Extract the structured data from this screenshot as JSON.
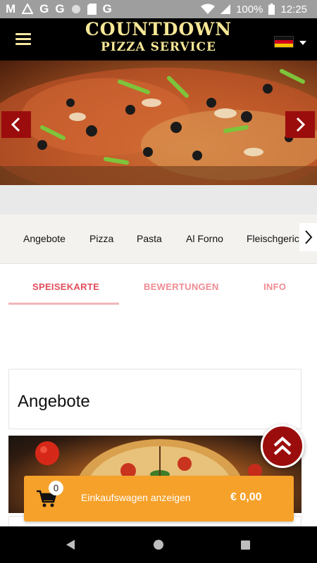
{
  "statusbar": {
    "left_glyphs": [
      "M",
      "G",
      "G",
      "G"
    ],
    "battery": "100%",
    "time": "12:25"
  },
  "header": {
    "logo_line1": "COUNTDOWN",
    "logo_line2": "PIZZA SERVICE",
    "language_flag": "de"
  },
  "categories": [
    "Angebote",
    "Pizza",
    "Pasta",
    "Al Forno",
    "Fleischgeric"
  ],
  "tabs": [
    "SPEISEKARTE",
    "BEWERTUNGEN",
    "INFO"
  ],
  "section": {
    "title": "Angebote"
  },
  "cart": {
    "count": "0",
    "label": "Einkaufswagen anzeigen",
    "total": "€ 0,00"
  },
  "colors": {
    "accent_red": "#9b0d0d",
    "cart_orange": "#f6a12a",
    "tab_active": "#e34d5a",
    "logo_gold": "#f7e796"
  },
  "icons": [
    "menu-icon",
    "flag-germany-icon",
    "chevron-left-icon",
    "chevron-right-icon",
    "double-chevron-up-icon",
    "cart-icon",
    "wifi-icon",
    "battery-icon"
  ]
}
